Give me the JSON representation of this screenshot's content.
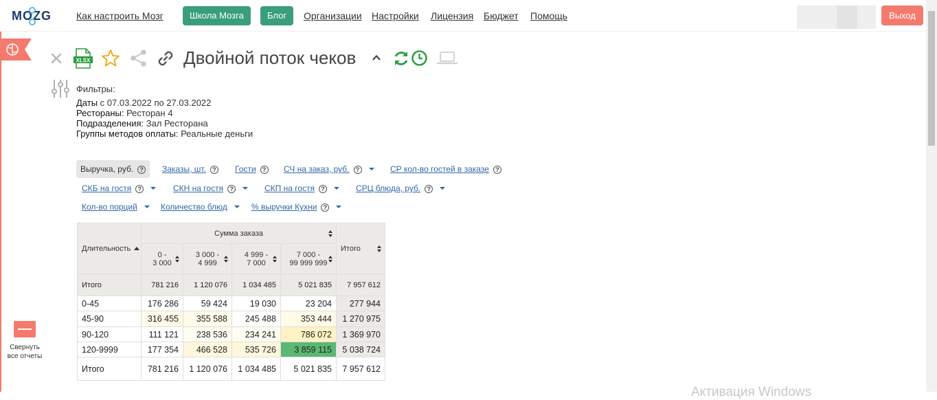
{
  "nav": {
    "logo_text": "MOZG",
    "links": [
      "Как настроить Мозг",
      "Организации",
      "Настройки",
      "Лицензия",
      "Бюджет",
      "Помощь"
    ],
    "btn_school": "Школа Мозга",
    "btn_blog": "Блог",
    "logout": "Выход"
  },
  "report": {
    "title": "Двойной поток чеков",
    "xlsx_label": "XLSX"
  },
  "filters": {
    "label": "Фильтры:",
    "lines": [
      {
        "key": "Даты",
        "value": " с 07.03.2022 по 27.03.2022"
      },
      {
        "key": "Рестораны:",
        "value": " Ресторан 4"
      },
      {
        "key": "Подразделения:",
        "value": " Зал Ресторана"
      },
      {
        "key": "Группы методов оплаты:",
        "value": " Реальные деньги"
      }
    ]
  },
  "metrics": {
    "revenue": "Выручка, руб.",
    "orders": "Заказы, шт.",
    "guests": "Гости",
    "avg_check": "СЧ на заказ, руб.",
    "avg_guests": "СР кол-во гостей в заказе",
    "skb": "СКБ на гостя",
    "skn": "СКН на гостя",
    "skp": "СКП на гостя",
    "src": "СРЦ блюда, руб.",
    "portions": "Кол-во порций",
    "dishes": "Количество блюд",
    "kitchen_pct": "% выручки Кухни",
    "help_glyph": "?"
  },
  "table": {
    "row_header": "Длительность",
    "group_header": "Сумма заказа",
    "total_header": "Итого",
    "columns": [
      {
        "l1": "0 -",
        "l2": "3 000"
      },
      {
        "l1": "3 000 -",
        "l2": "4 999"
      },
      {
        "l1": "4 999 -",
        "l2": "7 000"
      },
      {
        "l1": "7 000 -",
        "l2": "99 999 999"
      }
    ],
    "top_total": {
      "label": "Итого",
      "values": [
        "781 216",
        "1 120 076",
        "1 034 485",
        "5 021 835"
      ],
      "total": "7 957 612"
    },
    "rows": [
      {
        "label": "0-45",
        "values": [
          "176 286",
          "59 424",
          "19 030",
          "23 204"
        ],
        "total": "277 944"
      },
      {
        "label": "45-90",
        "values": [
          "316 455",
          "355 588",
          "245 488",
          "353 444"
        ],
        "total": "1 270 975"
      },
      {
        "label": "90-120",
        "values": [
          "111 121",
          "238 536",
          "234 241",
          "786 072"
        ],
        "total": "1 369 970"
      },
      {
        "label": "120-9999",
        "values": [
          "177 354",
          "466 528",
          "535 726",
          "3 859 115"
        ],
        "total": "5 038 724"
      }
    ],
    "bottom_total": {
      "label": "Итого",
      "values": [
        "781 216",
        "1 120 076",
        "1 034 485",
        "5 021 835"
      ],
      "total": "7 957 612"
    }
  },
  "sidebar": {
    "collapse_l1": "Свернуть",
    "collapse_l2": "все отчеты"
  },
  "watermark": "Активация Windows",
  "colors": {
    "accent_green": "#3a9e7c",
    "logout_red": "#f47a6e",
    "link_blue": "#3367a8",
    "header_bg": "#eceae6",
    "heat_light": "#fffbe8",
    "heat_mid": "#fff2c4",
    "heat_strong": "#5bb872"
  }
}
